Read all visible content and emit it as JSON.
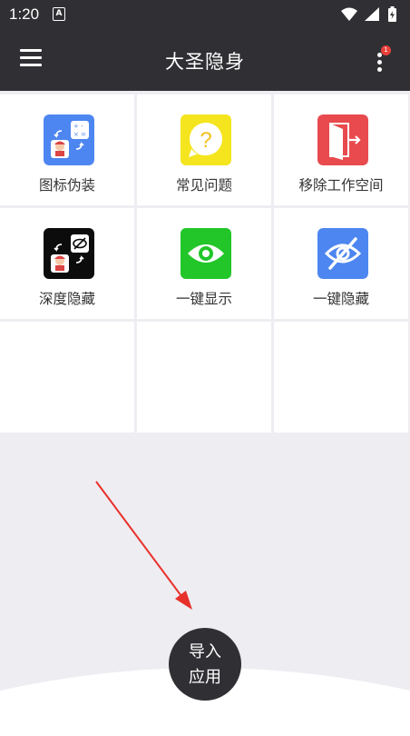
{
  "status": {
    "time": "1:20",
    "notification_glyph": "A"
  },
  "appbar": {
    "title": "大圣隐身",
    "badge": "1"
  },
  "grid": [
    {
      "label": "图标伪装",
      "icon": "icon-disguise-icon",
      "color": "#4d86f0"
    },
    {
      "label": "常见问题",
      "icon": "question-bubble-icon",
      "color": "#f5e51f"
    },
    {
      "label": "移除工作空间",
      "icon": "exit-door-icon",
      "color": "#e84a4e"
    },
    {
      "label": "深度隐藏",
      "icon": "deep-hide-icon",
      "color": "#0c0c0c"
    },
    {
      "label": "一键显示",
      "icon": "eye-icon",
      "color": "#22c629"
    },
    {
      "label": "一键隐藏",
      "icon": "eye-off-icon",
      "color": "#4d86f0"
    }
  ],
  "fab": {
    "line1": "导入",
    "line2": "应用"
  },
  "colors": {
    "bar": "#303034",
    "background": "#eeedf2",
    "arrow": "#e8302a"
  }
}
